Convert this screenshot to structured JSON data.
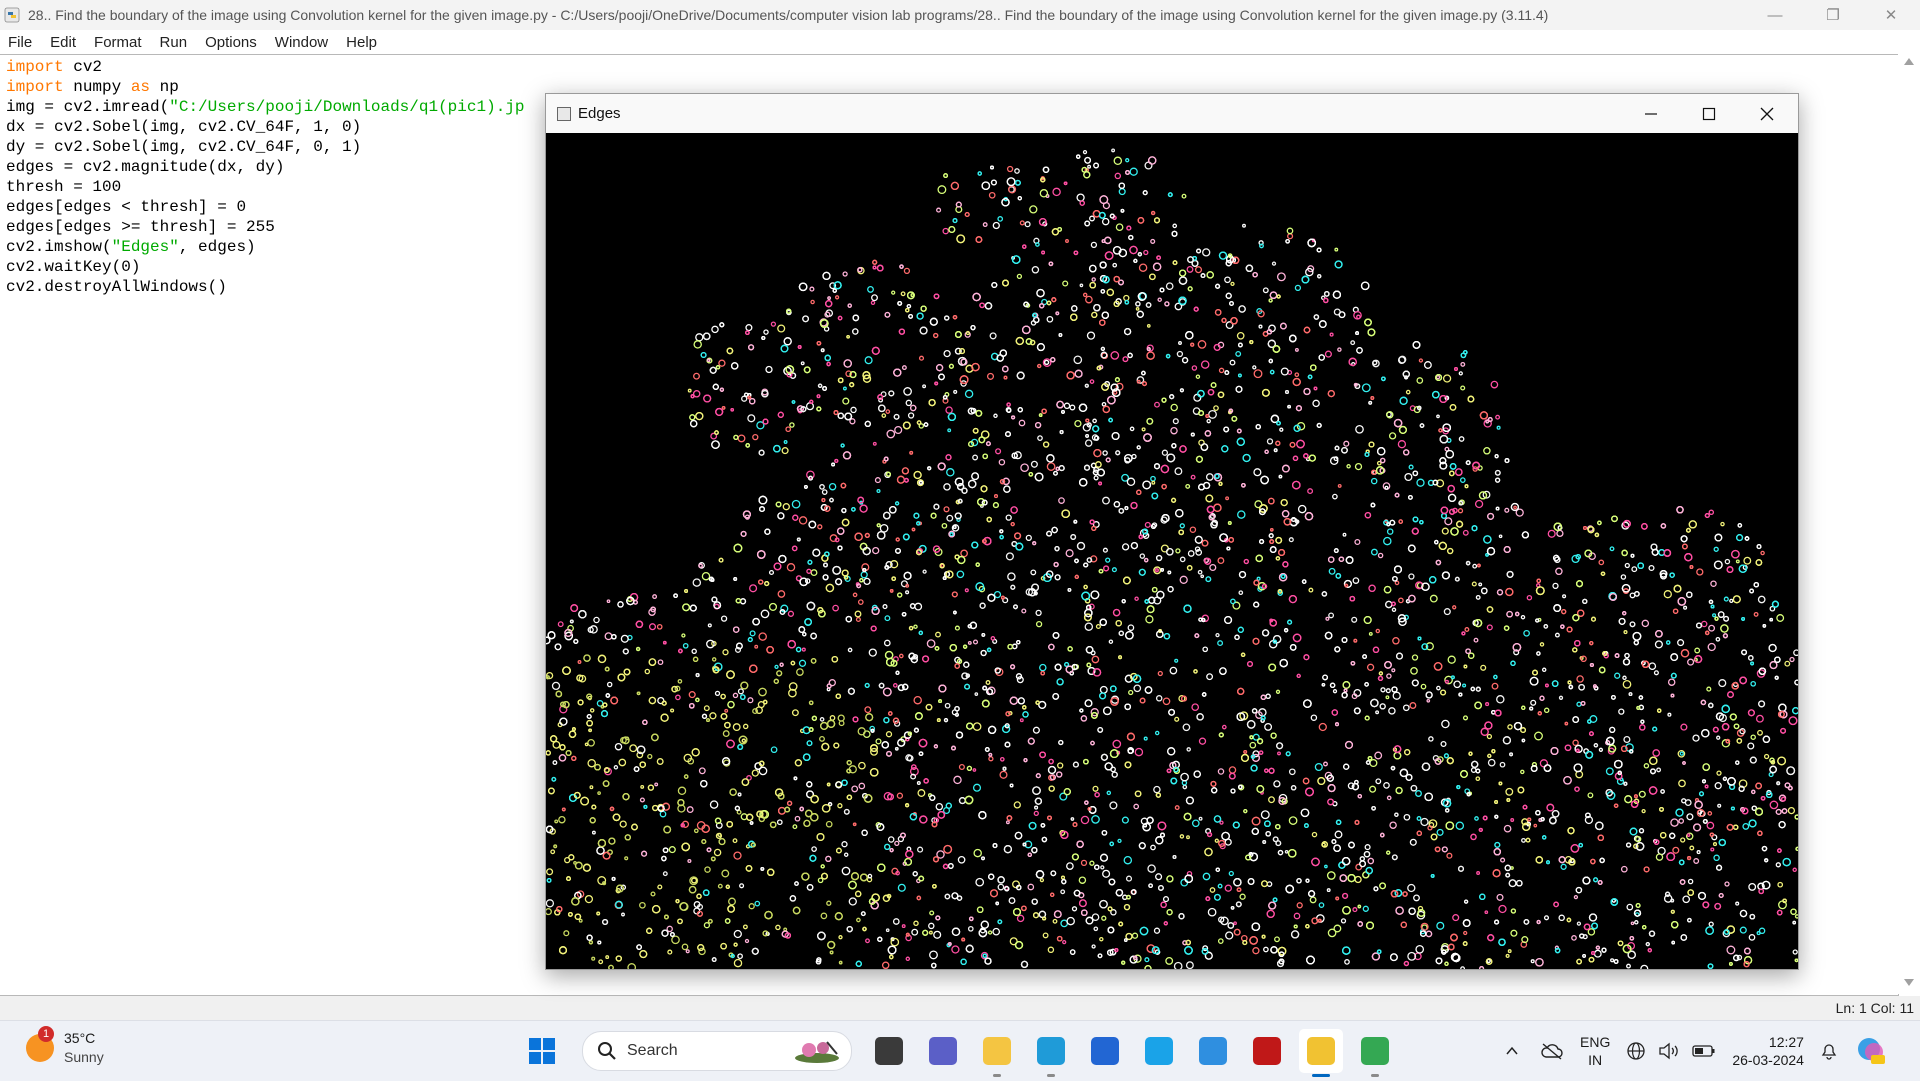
{
  "window": {
    "title": "28.. Find the boundary of the image using Convolution kernel for the given image.py - C:/Users/pooji/OneDrive/Documents/computer vision lab programs/28.. Find the boundary of the image using Convolution kernel for the given image.py (3.11.4)",
    "controls": [
      "—",
      "❐",
      "✕"
    ]
  },
  "menu": [
    "File",
    "Edit",
    "Format",
    "Run",
    "Options",
    "Window",
    "Help"
  ],
  "code": [
    [
      {
        "t": "import",
        "c": "kw"
      },
      {
        "t": " cv2",
        "c": ""
      }
    ],
    [
      {
        "t": "import",
        "c": "kw"
      },
      {
        "t": " numpy ",
        "c": ""
      },
      {
        "t": "as",
        "c": "kw"
      },
      {
        "t": " np",
        "c": ""
      }
    ],
    [
      {
        "t": "img = cv2.imread(",
        "c": ""
      },
      {
        "t": "\"C:/Users/pooji/Downloads/q1(pic1).jp",
        "c": "str"
      }
    ],
    [
      {
        "t": "dx = cv2.Sobel(img, cv2.CV_64F, 1, 0)",
        "c": ""
      }
    ],
    [
      {
        "t": "dy = cv2.Sobel(img, cv2.CV_64F, 0, 1)",
        "c": ""
      }
    ],
    [
      {
        "t": "edges = cv2.magnitude(dx, dy)",
        "c": ""
      }
    ],
    [
      {
        "t": "thresh = 100",
        "c": ""
      }
    ],
    [
      {
        "t": "edges[edges < thresh] = 0",
        "c": ""
      }
    ],
    [
      {
        "t": "edges[edges >= thresh] = 255",
        "c": ""
      }
    ],
    [
      {
        "t": "cv2.imshow(",
        "c": ""
      },
      {
        "t": "\"Edges\"",
        "c": "str"
      },
      {
        "t": ", edges)",
        "c": ""
      }
    ],
    [
      {
        "t": "cv2.waitKey(0)",
        "c": ""
      }
    ],
    [
      {
        "t": "cv2.destroyAllWindows()",
        "c": ""
      }
    ]
  ],
  "status": {
    "position": "Ln: 1   Col: 11"
  },
  "edges_window": {
    "title": "Edges"
  },
  "taskbar": {
    "weather": {
      "temp": "35°C",
      "condition": "Sunny",
      "badge": "1"
    },
    "search_label": "Search",
    "apps": [
      {
        "name": "task-view",
        "color": "#3a3a3a",
        "running": false
      },
      {
        "name": "teams",
        "color": "#5b5fc7",
        "running": false
      },
      {
        "name": "file-explorer",
        "color": "#f4c542",
        "running": true
      },
      {
        "name": "edge",
        "color": "#1f9bd8",
        "running": true
      },
      {
        "name": "microsoft-store",
        "color": "#2266d3",
        "running": false
      },
      {
        "name": "myhp",
        "color": "#1aa3e8",
        "running": false
      },
      {
        "name": "help",
        "color": "#2f8fe0",
        "running": false
      },
      {
        "name": "mcafee",
        "color": "#c01818",
        "running": false
      },
      {
        "name": "python-idle",
        "color": "#f1c232",
        "running": true,
        "active": true
      },
      {
        "name": "chrome",
        "color": "#34a853",
        "running": true
      }
    ],
    "lang": {
      "line1": "ENG",
      "line2": "IN"
    },
    "clock": {
      "time": "12:27",
      "date": "26-03-2024"
    }
  },
  "colors": {
    "keyword": "#ff7700",
    "string": "#00aa00",
    "accent": "#0067c0"
  }
}
